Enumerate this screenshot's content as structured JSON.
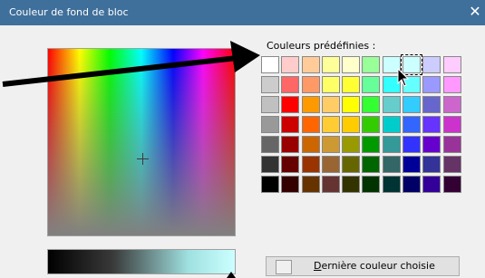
{
  "window": {
    "title": "Couleur de fond de bloc",
    "close_glyph": "✕"
  },
  "presets": {
    "label": "Couleurs prédéfinies :",
    "selected_index": 7,
    "colors": [
      "#ffffff",
      "#ffcccc",
      "#ffcc99",
      "#ffff99",
      "#ffffcc",
      "#99ff99",
      "#ccffff",
      "#ccffff",
      "#ccccff",
      "#ffccff",
      "#cccccc",
      "#ff6666",
      "#ff9966",
      "#ffff66",
      "#ffff33",
      "#66ff99",
      "#33ffff",
      "#66ffff",
      "#9999ff",
      "#ff99ff",
      "#c0c0c0",
      "#ff0000",
      "#ff9900",
      "#ffcc66",
      "#ffff00",
      "#33ff33",
      "#66cccc",
      "#33ccff",
      "#6666cc",
      "#cc66cc",
      "#999999",
      "#cc0000",
      "#ff6600",
      "#ffcc33",
      "#ffcc00",
      "#33cc00",
      "#00cccc",
      "#3366ff",
      "#6633ff",
      "#cc33cc",
      "#666666",
      "#990000",
      "#cc6600",
      "#cc9933",
      "#999900",
      "#009900",
      "#339999",
      "#3333ff",
      "#6600cc",
      "#993399",
      "#333333",
      "#660000",
      "#993300",
      "#996633",
      "#666600",
      "#006600",
      "#336666",
      "#000099",
      "#333399",
      "#663366",
      "#000000",
      "#330000",
      "#663300",
      "#663333",
      "#333300",
      "#003300",
      "#003333",
      "#000066",
      "#330099",
      "#330033"
    ]
  },
  "last_color": {
    "label_underlined": "D",
    "label_rest": "ernière couleur choisie"
  },
  "icons": {
    "close": "close-icon",
    "cursor": "mouse-cursor-icon",
    "crosshair": "crosshair-icon"
  }
}
